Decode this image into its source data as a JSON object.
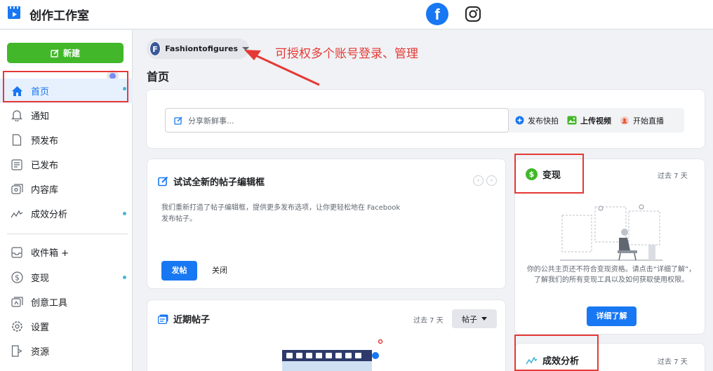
{
  "app": {
    "title": "创作工作室"
  },
  "platform_tabs": [
    {
      "name": "facebook",
      "icon": "facebook-icon",
      "glyph": "f",
      "active": true
    },
    {
      "name": "instagram",
      "icon": "instagram-icon",
      "active": false
    }
  ],
  "sidebar": {
    "new_button": {
      "label": "新建",
      "icon": "edit-icon"
    },
    "items": [
      {
        "label": "首页",
        "icon": "home-icon",
        "active": true,
        "dot": true
      },
      {
        "label": "通知",
        "icon": "bell-icon",
        "active": false,
        "dot": false
      },
      {
        "label": "预发布",
        "icon": "document-icon",
        "active": false,
        "dot": false
      },
      {
        "label": "已发布",
        "icon": "published-icon",
        "active": false,
        "dot": false
      },
      {
        "label": "内容库",
        "icon": "library-icon",
        "active": false,
        "dot": false
      },
      {
        "label": "成效分析",
        "icon": "insights-icon",
        "active": false,
        "dot": true
      },
      {
        "label": "收件箱 +",
        "icon": "inbox-icon",
        "active": false,
        "dot": false
      },
      {
        "label": "变现",
        "icon": "dollar-icon",
        "active": false,
        "dot": true
      },
      {
        "label": "创意工具",
        "icon": "creative-tools-icon",
        "active": false,
        "dot": false
      },
      {
        "label": "设置",
        "icon": "gear-icon",
        "active": false,
        "dot": false
      },
      {
        "label": "资源",
        "icon": "resources-icon",
        "active": false,
        "dot": false
      }
    ]
  },
  "account": {
    "initial": "F",
    "name": "Fashiontofigures"
  },
  "annotation": "可授权多个账号登录、管理",
  "page_title": "首页",
  "composer": {
    "placeholder": "分享新鲜事...",
    "actions": [
      {
        "label": "发布快拍",
        "icon": "story-icon"
      },
      {
        "label": "上传视频",
        "icon": "video-upload-icon"
      },
      {
        "label": "开始直播",
        "icon": "live-icon"
      }
    ]
  },
  "try_editor": {
    "title": "试试全新的帖子编辑框",
    "description": "我们重新打造了帖子编辑框，提供更多发布选项，让你更轻松地在 Facebook 发布帖子。",
    "post_button": "发帖",
    "close_button": "关闭",
    "prev_icon": "‹",
    "next_icon": "›"
  },
  "recent_posts": {
    "title": "近期帖子",
    "period": "过去 7 天",
    "filter": "帖子"
  },
  "monetization": {
    "title": "变现",
    "period": "过去 7 天",
    "description": "你的公共主页还不符合变现资格。请点击“详细了解”，了解我们的所有变现工具以及如何获取使用权限。",
    "button": "详细了解"
  },
  "analytics": {
    "title": "成效分析",
    "period": "过去 7 天"
  },
  "colors": {
    "brand_blue": "#1877f2",
    "green": "#42b72a",
    "annotation_red": "#e53935"
  }
}
